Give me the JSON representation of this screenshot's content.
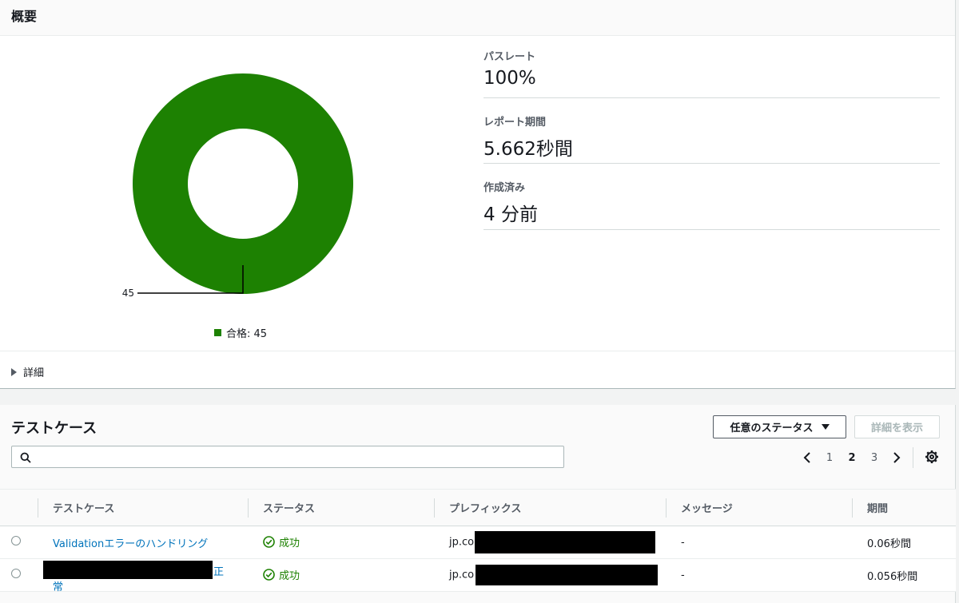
{
  "summary": {
    "title": "概要",
    "metrics": [
      {
        "label": "パスレート",
        "value": "100%"
      },
      {
        "label": "レポート期間",
        "value": "5.662秒間"
      },
      {
        "label": "作成済み",
        "value": "4 分前"
      }
    ],
    "details_label": "詳細"
  },
  "chart_data": {
    "type": "pie",
    "donut": true,
    "slices": [
      {
        "label": "合格",
        "value": 45,
        "color": "#1d8102"
      }
    ],
    "data_label": "45",
    "legend": "合格: 45",
    "legend_position": "bottom"
  },
  "cases": {
    "title": "テストケース",
    "status_filter": "任意のステータス",
    "view_details": "詳細を表示",
    "search": {
      "placeholder": "",
      "value": ""
    },
    "pagination": {
      "pages": [
        "1",
        "2",
        "3"
      ],
      "current": "2"
    },
    "columns": [
      "テストケース",
      "ステータス",
      "プレフィックス",
      "メッセージ",
      "期間"
    ],
    "rows": [
      {
        "name": "Validationエラーのハンドリング",
        "status": "成功",
        "prefix": "jp.co.",
        "message": "-",
        "duration": "0.06秒間"
      },
      {
        "name_tail1": "正",
        "name_tail2": "常",
        "status": "成功",
        "prefix": "jp.co",
        "message": "-",
        "duration": "0.056秒間"
      }
    ]
  },
  "colors": {
    "success": "#1d8102",
    "link": "#0073bb"
  }
}
